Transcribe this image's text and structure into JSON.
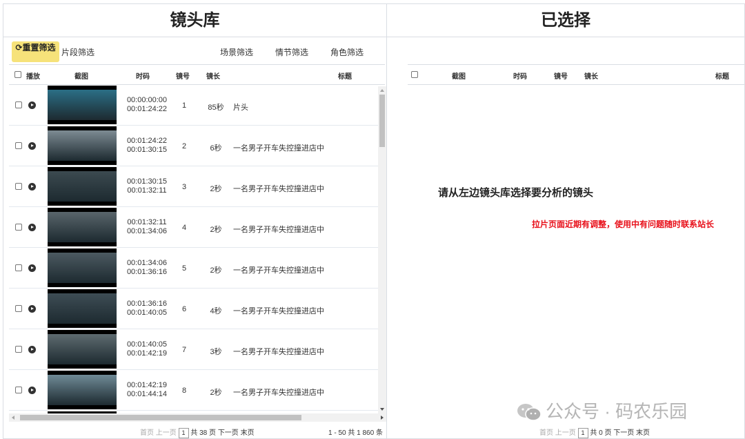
{
  "left_panel": {
    "title": "镜头库",
    "reset_button": "重置筛选",
    "filters": {
      "segment": "片段筛选",
      "scene": "场景筛选",
      "plot": "情节筛选",
      "role": "角色筛选"
    },
    "columns": {
      "play": "播放",
      "thumb": "截图",
      "timecode": "时码",
      "shot_no": "镜号",
      "length": "镜长",
      "title": "标题"
    },
    "rows": [
      {
        "tc_in": "00:00:00:00",
        "tc_out": "00:01:24:22",
        "shot_no": "1",
        "length": "85秒",
        "title": "片头",
        "thumb_color": "#2b6f86"
      },
      {
        "tc_in": "00:01:24:22",
        "tc_out": "00:01:30:15",
        "shot_no": "2",
        "length": "6秒",
        "title": "一名男子开车失控撞进店中",
        "thumb_color": "#7d8b93"
      },
      {
        "tc_in": "00:01:30:15",
        "tc_out": "00:01:32:11",
        "shot_no": "3",
        "length": "2秒",
        "title": "一名男子开车失控撞进店中",
        "thumb_color": "#3c4a50"
      },
      {
        "tc_in": "00:01:32:11",
        "tc_out": "00:01:34:06",
        "shot_no": "4",
        "length": "2秒",
        "title": "一名男子开车失控撞进店中",
        "thumb_color": "#59656b"
      },
      {
        "tc_in": "00:01:34:06",
        "tc_out": "00:01:36:16",
        "shot_no": "5",
        "length": "2秒",
        "title": "一名男子开车失控撞进店中",
        "thumb_color": "#4c5a61"
      },
      {
        "tc_in": "00:01:36:16",
        "tc_out": "00:01:40:05",
        "shot_no": "6",
        "length": "4秒",
        "title": "一名男子开车失控撞进店中",
        "thumb_color": "#3e4d55"
      },
      {
        "tc_in": "00:01:40:05",
        "tc_out": "00:01:42:19",
        "shot_no": "7",
        "length": "3秒",
        "title": "一名男子开车失控撞进店中",
        "thumb_color": "#5e6b70"
      },
      {
        "tc_in": "00:01:42:19",
        "tc_out": "00:01:44:14",
        "shot_no": "8",
        "length": "2秒",
        "title": "一名男子开车失控撞进店中",
        "thumb_color": "#6f8a96"
      }
    ],
    "pager": {
      "first": "首页",
      "prev": "上一页",
      "page": "1",
      "total": "共 38 页",
      "next": "下一页",
      "last": "末页",
      "range": "1 - 50",
      "count": "共 1 860 条"
    }
  },
  "right_panel": {
    "title": "已选择",
    "columns": {
      "thumb": "截图",
      "timecode": "时码",
      "shot_no": "镜号",
      "length": "镜长",
      "title": "标题"
    },
    "empty_message": "请从左边镜头库选择要分析的镜头",
    "notice": "拉片页面近期有调整，使用中有问题随时联系站长",
    "pager": {
      "first": "首页",
      "prev": "上一页",
      "page": "1",
      "total": "共 0 页",
      "next": "下一页",
      "last": "末页"
    }
  },
  "watermark": "公众号 · 码农乐园"
}
